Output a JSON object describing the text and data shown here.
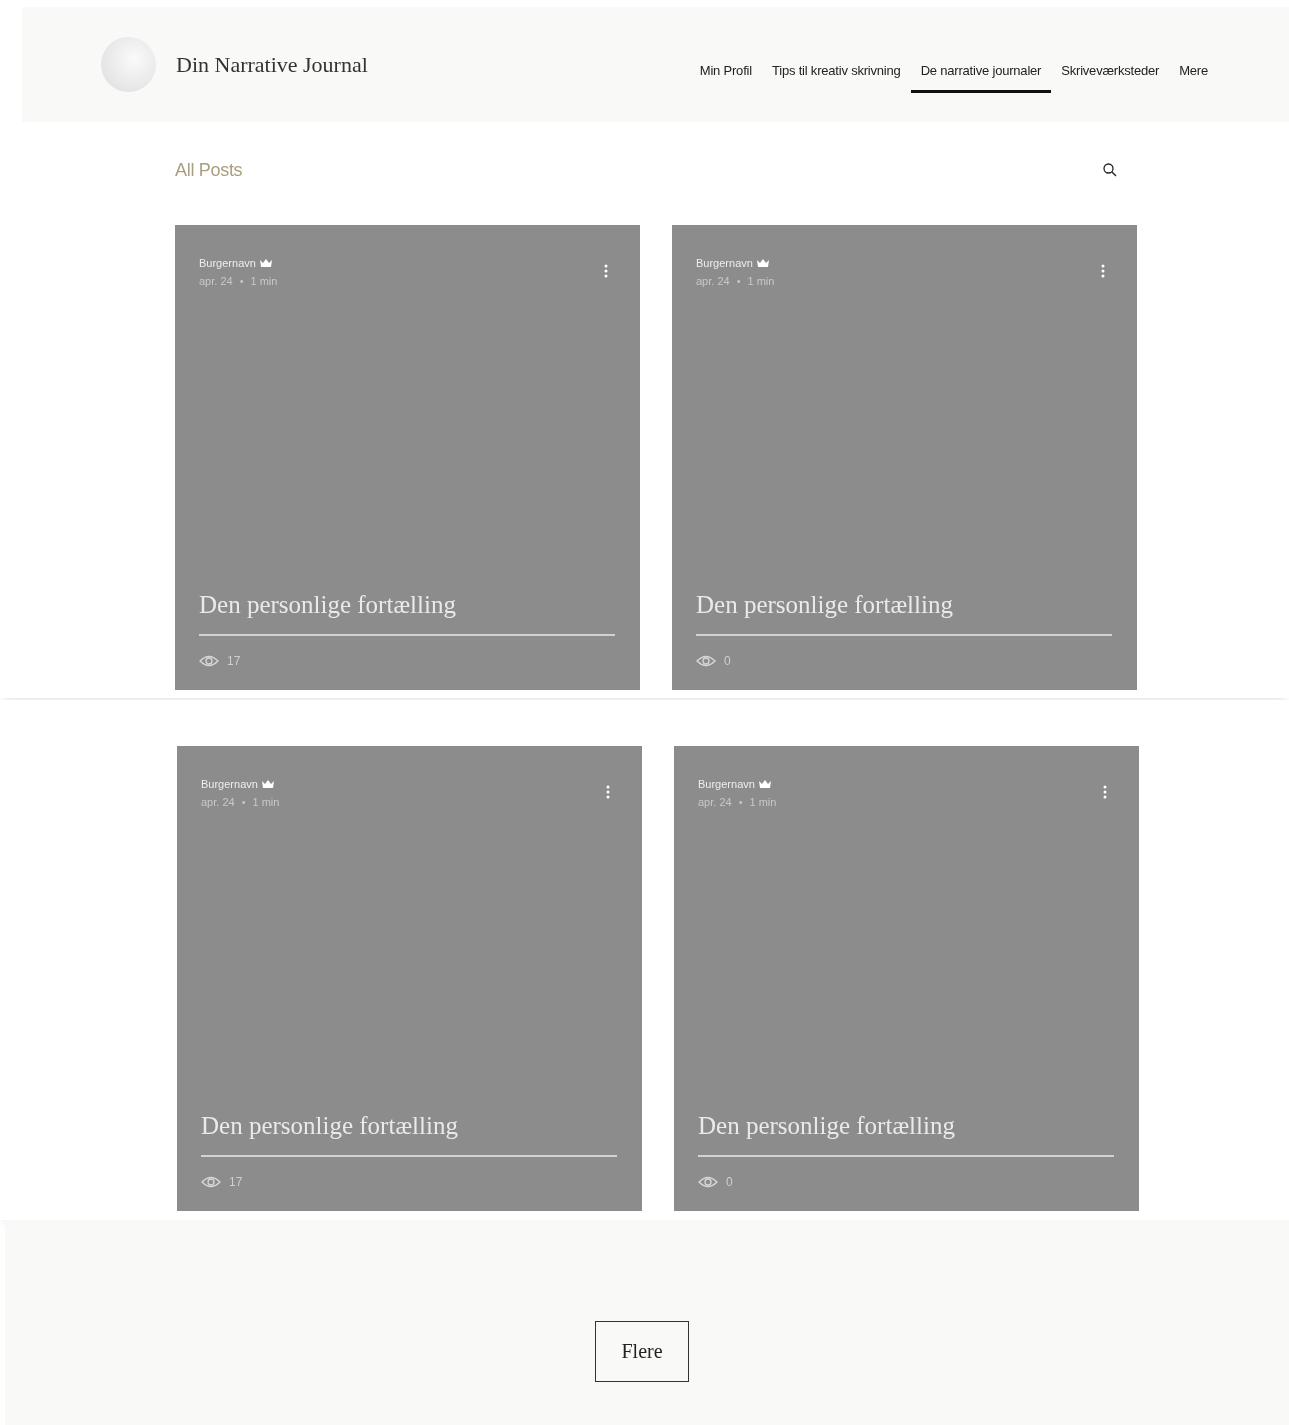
{
  "header": {
    "site_title": "Din Narrative Journal",
    "nav": [
      {
        "label": "Min Profil",
        "selected": false
      },
      {
        "label": "Tips til kreativ skrivning",
        "selected": false
      },
      {
        "label": "De narrative journaler",
        "selected": true
      },
      {
        "label": "Skriveværksteder",
        "selected": false
      },
      {
        "label": "Mere",
        "selected": false
      }
    ]
  },
  "toolbar": {
    "label": "All Posts"
  },
  "posts": [
    {
      "author": "Burgernavn",
      "date": "apr. 24",
      "separator": "•",
      "read_time": "1 min",
      "title": "Den personlige fortælling",
      "views": "17"
    },
    {
      "author": "Burgernavn",
      "date": "apr. 24",
      "separator": "•",
      "read_time": "1 min",
      "title": "Den personlige fortælling",
      "views": "0"
    },
    {
      "author": "Burgernavn",
      "date": "apr. 24",
      "separator": "•",
      "read_time": "1 min",
      "title": "Den personlige fortælling",
      "views": "17"
    },
    {
      "author": "Burgernavn",
      "date": "apr. 24",
      "separator": "•",
      "read_time": "1 min",
      "title": "Den personlige fortælling",
      "views": "0"
    }
  ],
  "load_more": "Flere"
}
